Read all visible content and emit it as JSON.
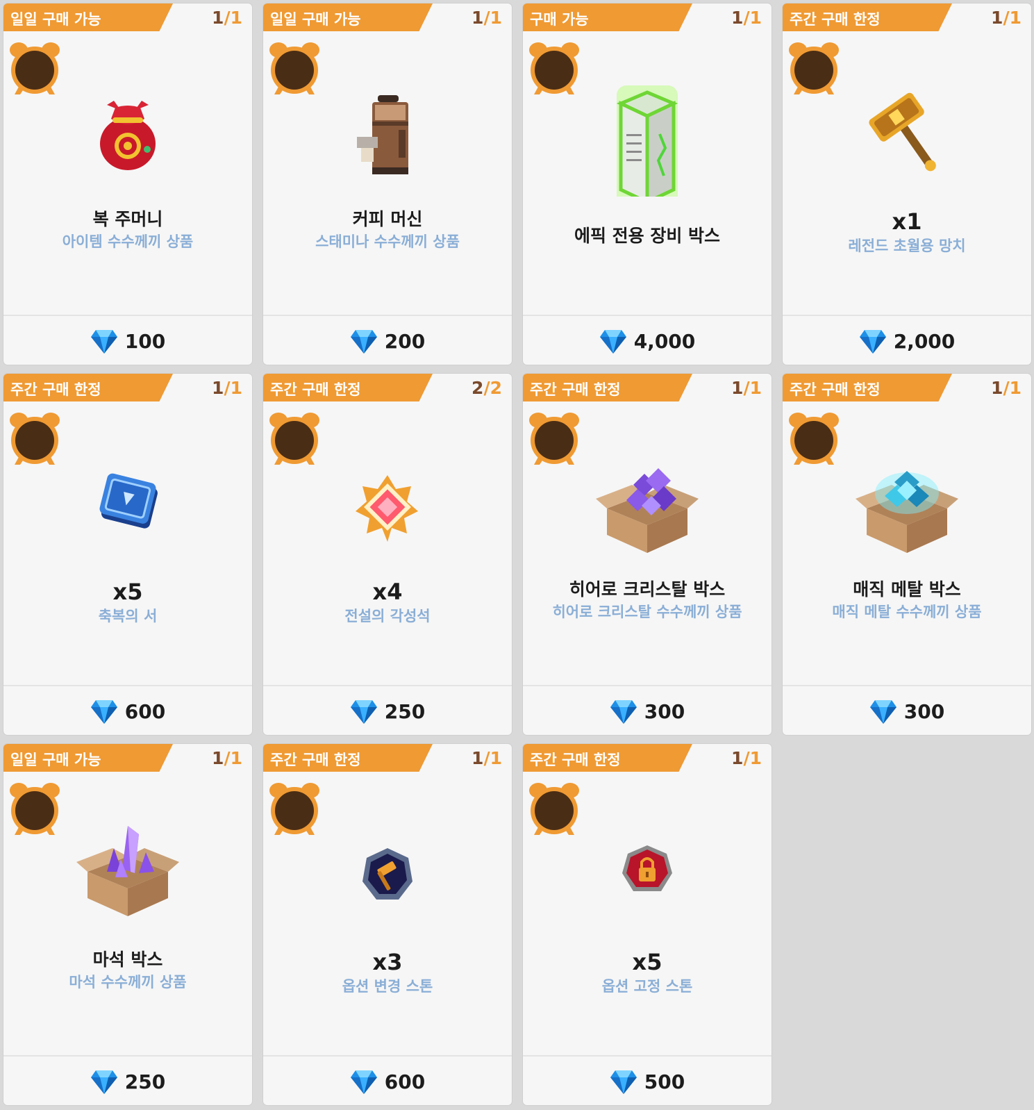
{
  "colors": {
    "tag_bg": "#ef9a33",
    "page_bg": "#d9d9d9",
    "card_bg": "#f6f6f6",
    "subtitle": "#8aaed6",
    "limit_current": "#7a4a2c",
    "limit_max": "#ef9a33",
    "clock": "#4a2d15"
  },
  "currency_icon": "blue-diamond-gem-icon",
  "items": [
    {
      "tag": "일일 구매 가능",
      "limit_current": "1",
      "limit_sep": "/",
      "limit_max": "1",
      "title": "복 주머니",
      "subtitle": "아이템 수수께끼 상품",
      "price": "100",
      "icon": "red-lucky-pouch-icon"
    },
    {
      "tag": "일일 구매 가능",
      "limit_current": "1",
      "limit_sep": "/",
      "limit_max": "1",
      "title": "커피 머신",
      "subtitle": "스태미나 수수께끼 상품",
      "price": "200",
      "icon": "coffee-machine-icon"
    },
    {
      "tag": "구매 가능",
      "limit_current": "1",
      "limit_sep": "/",
      "limit_max": "1",
      "title": "에픽 전용 장비 박스",
      "subtitle": "",
      "price": "4,000",
      "icon": "epic-equipment-box-icon"
    },
    {
      "tag": "주간 구매 한정",
      "limit_current": "1",
      "limit_sep": "/",
      "limit_max": "1",
      "title": "x1",
      "subtitle": "레전드 초월용 망치",
      "price": "2,000",
      "icon": "golden-hammer-icon"
    },
    {
      "tag": "주간 구매 한정",
      "limit_current": "1",
      "limit_sep": "/",
      "limit_max": "1",
      "title": "x5",
      "subtitle": "축복의 서",
      "price": "600",
      "icon": "blue-book-icon"
    },
    {
      "tag": "주간 구매 한정",
      "limit_current": "2",
      "limit_sep": "/",
      "limit_max": "2",
      "title": "x4",
      "subtitle": "전설의 각성석",
      "price": "250",
      "icon": "legendary-awakening-stone-icon"
    },
    {
      "tag": "주간 구매 한정",
      "limit_current": "1",
      "limit_sep": "/",
      "limit_max": "1",
      "title": "히어로 크리스탈 박스",
      "subtitle": "히어로 크리스탈 수수께끼 상품",
      "price": "300",
      "icon": "purple-crystal-box-icon"
    },
    {
      "tag": "주간 구매 한정",
      "limit_current": "1",
      "limit_sep": "/",
      "limit_max": "1",
      "title": "매직 메탈 박스",
      "subtitle": "매직 메탈 수수께끼 상품",
      "price": "300",
      "icon": "cyan-metal-box-icon"
    },
    {
      "tag": "일일 구매 가능",
      "limit_current": "1",
      "limit_sep": "/",
      "limit_max": "1",
      "title": "마석 박스",
      "subtitle": "마석 수수께끼 상품",
      "price": "250",
      "icon": "magic-stone-box-icon"
    },
    {
      "tag": "주간 구매 한정",
      "limit_current": "1",
      "limit_sep": "/",
      "limit_max": "1",
      "title": "x3",
      "subtitle": "옵션 변경 스톤",
      "price": "600",
      "icon": "option-change-stone-icon"
    },
    {
      "tag": "주간 구매 한정",
      "limit_current": "1",
      "limit_sep": "/",
      "limit_max": "1",
      "title": "x5",
      "subtitle": "옵션 고정 스톤",
      "price": "500",
      "icon": "option-lock-stone-icon"
    }
  ]
}
